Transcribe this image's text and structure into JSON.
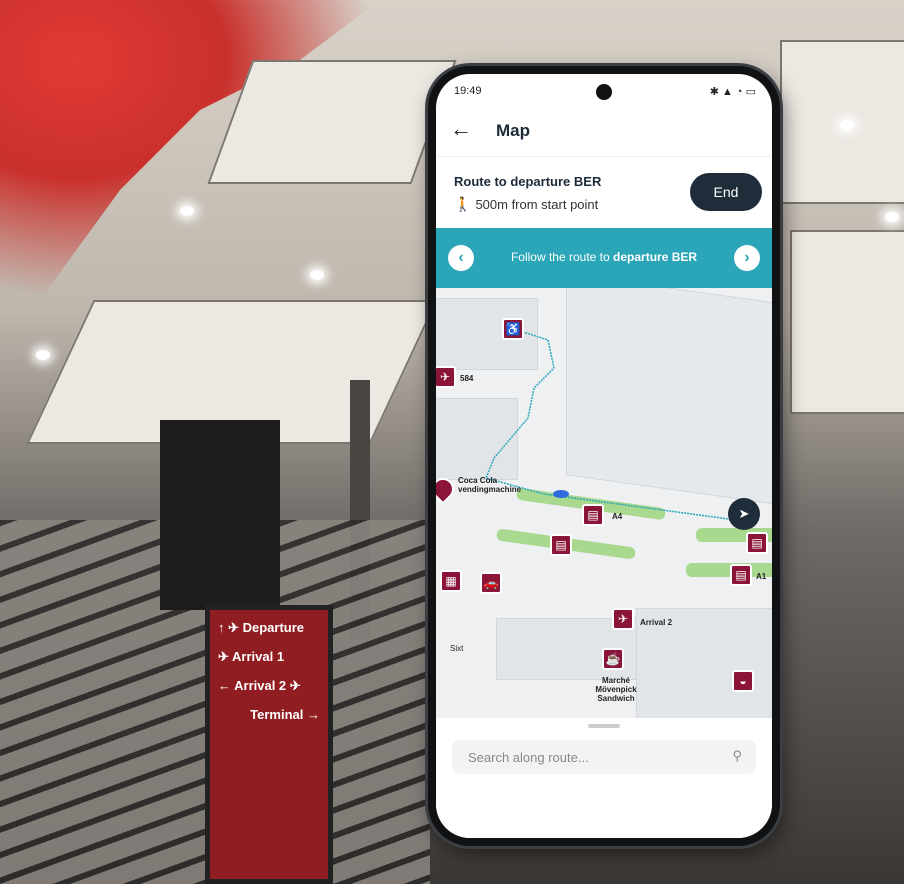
{
  "status_bar": {
    "time": "19:49"
  },
  "app_bar": {
    "back_icon": "←",
    "title": "Map"
  },
  "route": {
    "title": "Route to departure BER",
    "distance": "500m from start point",
    "end_label": "End"
  },
  "banner": {
    "prefix": "Follow the route to ",
    "target": "departure BER",
    "prev_icon": "‹",
    "next_icon": "›"
  },
  "map": {
    "labels": {
      "g84": "584",
      "coca_cola": "Coca Cola vendingmachine",
      "a4": "A4",
      "a1": "A1",
      "arrival2": "Arrival 2",
      "sixt": "Sixt",
      "marche": "Marché Mövenpick Sandwich"
    }
  },
  "search": {
    "placeholder": "Search along route..."
  },
  "colors": {
    "accent": "#2aa6b8",
    "poi": "#8a1538",
    "dark": "#1f2d3a"
  }
}
